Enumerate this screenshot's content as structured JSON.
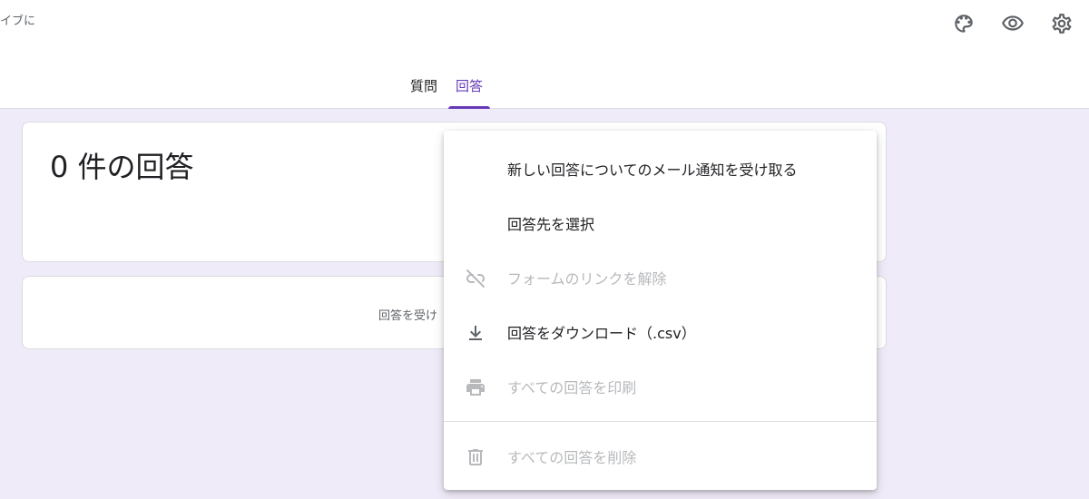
{
  "header": {
    "save_status": "イブに",
    "icons": [
      "palette-icon",
      "eye-icon",
      "gear-icon"
    ]
  },
  "tabs": [
    {
      "label": "質問",
      "active": false
    },
    {
      "label": "回答",
      "active": true
    }
  ],
  "summary": {
    "response_count": "0 件の回答"
  },
  "accepting": {
    "text": "回答を受け"
  },
  "menu": {
    "items": [
      {
        "label": "新しい回答についてのメール通知を受け取る",
        "icon": "",
        "disabled": false
      },
      {
        "label": "回答先を選択",
        "icon": "",
        "disabled": false
      },
      {
        "label": "フォームのリンクを解除",
        "icon": "link-off-icon",
        "disabled": true
      },
      {
        "label": "回答をダウンロード（.csv）",
        "icon": "download-icon",
        "disabled": false
      },
      {
        "label": "すべての回答を印刷",
        "icon": "print-icon",
        "disabled": true
      },
      {
        "label": "すべての回答を削除",
        "icon": "trash-icon",
        "disabled": true
      }
    ]
  },
  "colors": {
    "accent": "#673ab7",
    "background": "#f0ebf8",
    "disabled_text": "#b7b9bc"
  }
}
